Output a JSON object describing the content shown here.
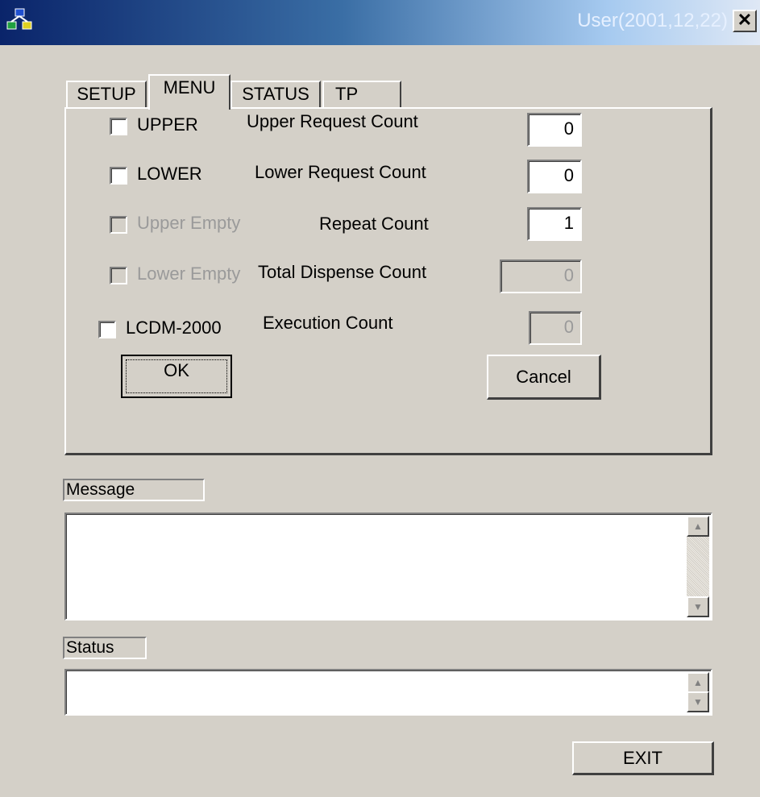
{
  "window": {
    "title": "User(2001,12,22)",
    "close_label": "✕",
    "icon": "app-network-icon"
  },
  "tabs": [
    {
      "label": "SETUP",
      "active": false
    },
    {
      "label": "MENU",
      "active": true
    },
    {
      "label": "STATUS",
      "active": false
    },
    {
      "label": "TP",
      "active": false
    }
  ],
  "options": {
    "upper": {
      "label": "UPPER",
      "checked": false,
      "enabled": true
    },
    "lower": {
      "label": "LOWER",
      "checked": false,
      "enabled": true
    },
    "upper_empty": {
      "label": "Upper Empty",
      "checked": false,
      "enabled": false
    },
    "lower_empty": {
      "label": "Lower Empty",
      "checked": false,
      "enabled": false
    },
    "lcdm": {
      "label": "LCDM-2000",
      "checked": false,
      "enabled": true
    }
  },
  "counts": {
    "upper_request": {
      "label": "Upper Request Count",
      "value": "0",
      "enabled": true
    },
    "lower_request": {
      "label": "Lower Request Count",
      "value": "0",
      "enabled": true
    },
    "repeat": {
      "label": "Repeat Count",
      "value": "1",
      "enabled": true
    },
    "total_dispense": {
      "label": "Total Dispense Count",
      "value": "0",
      "enabled": false
    },
    "execution": {
      "label": "Execution Count",
      "value": "0",
      "enabled": false
    }
  },
  "buttons": {
    "ok": "OK",
    "cancel": "Cancel",
    "exit": "EXIT"
  },
  "message": {
    "label": "Message",
    "text": ""
  },
  "status": {
    "label": "Status",
    "text": ""
  },
  "scroll_arrows": {
    "up": "▲",
    "down": "▼"
  },
  "colors": {
    "titlebar_start": "#0a246a",
    "titlebar_end": "#a6caf0",
    "face": "#d4d0c8",
    "disabled_text": "#9a9a9a"
  }
}
